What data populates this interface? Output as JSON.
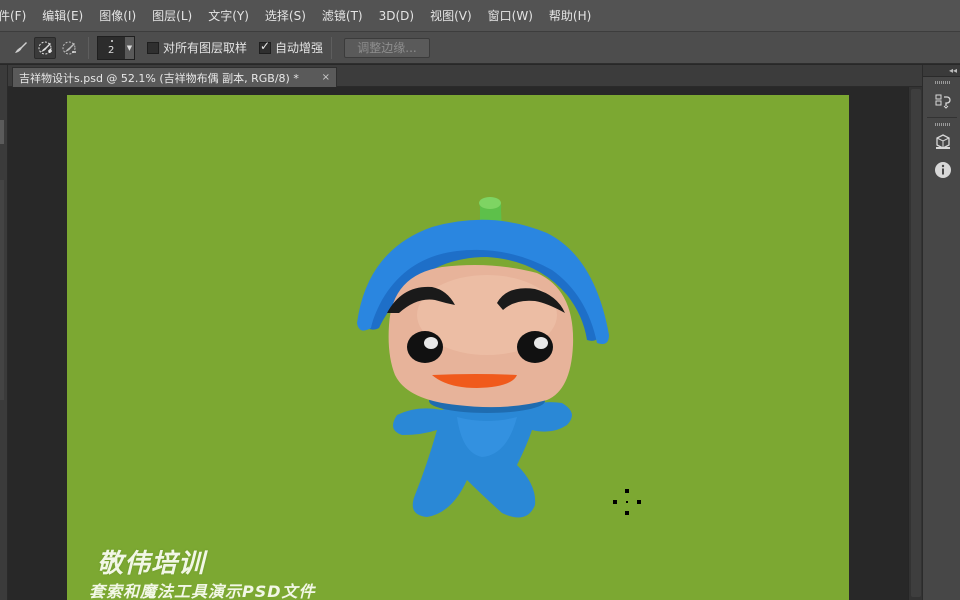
{
  "menu": {
    "items": [
      {
        "label": "件(F)"
      },
      {
        "label": "编辑(E)"
      },
      {
        "label": "图像(I)"
      },
      {
        "label": "图层(L)"
      },
      {
        "label": "文字(Y)"
      },
      {
        "label": "选择(S)"
      },
      {
        "label": "滤镜(T)"
      },
      {
        "label": "3D(D)"
      },
      {
        "label": "视图(V)"
      },
      {
        "label": "窗口(W)"
      },
      {
        "label": "帮助(H)"
      }
    ]
  },
  "options": {
    "tools": [
      "quick-selection-new-icon",
      "quick-selection-add-icon",
      "quick-selection-subtract-icon"
    ],
    "brush_size": "2",
    "sample_all_layers_label": "对所有图层取样",
    "sample_all_layers_checked": false,
    "auto_enhance_label": "自动增强",
    "auto_enhance_checked": true,
    "refine_edge_label": "调整边缘..."
  },
  "document": {
    "tab_title": "吉祥物设计s.psd @ 52.1% (吉祥物布偶 副本, RGB/8) *",
    "close_symbol": "×",
    "background_color": "#7ca832",
    "watermark_title": "敬伟培训",
    "watermark_subtitle": "套索和魔法工具演示PSD文件"
  },
  "right_dock": {
    "icons": [
      "history-icon",
      "3d-icon",
      "info-icon"
    ],
    "collapse_symbol": "◂◂"
  }
}
